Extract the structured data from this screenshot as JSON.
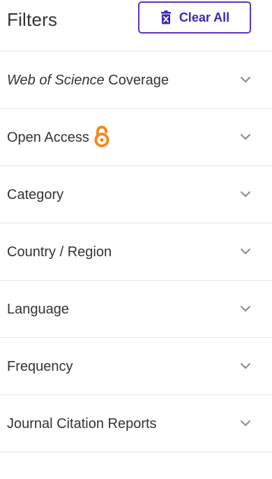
{
  "header": {
    "title": "Filters",
    "clear_label": "Clear All"
  },
  "filters": [
    {
      "label_italic": "Web of Science",
      "label_rest": " Coverage"
    },
    {
      "label": "Open Access",
      "badge_icon": "open-access-lock-icon"
    },
    {
      "label": "Category"
    },
    {
      "label": "Country / Region"
    },
    {
      "label": "Language"
    },
    {
      "label": "Frequency"
    },
    {
      "label": "Journal Citation Reports"
    }
  ],
  "colors": {
    "accent": "#5e33bf",
    "accent_text": "#3b2ab0",
    "open_access": "#f28a1e",
    "text": "#333333",
    "divider": "#e6e6e6",
    "chevron": "#8a8a8a"
  }
}
